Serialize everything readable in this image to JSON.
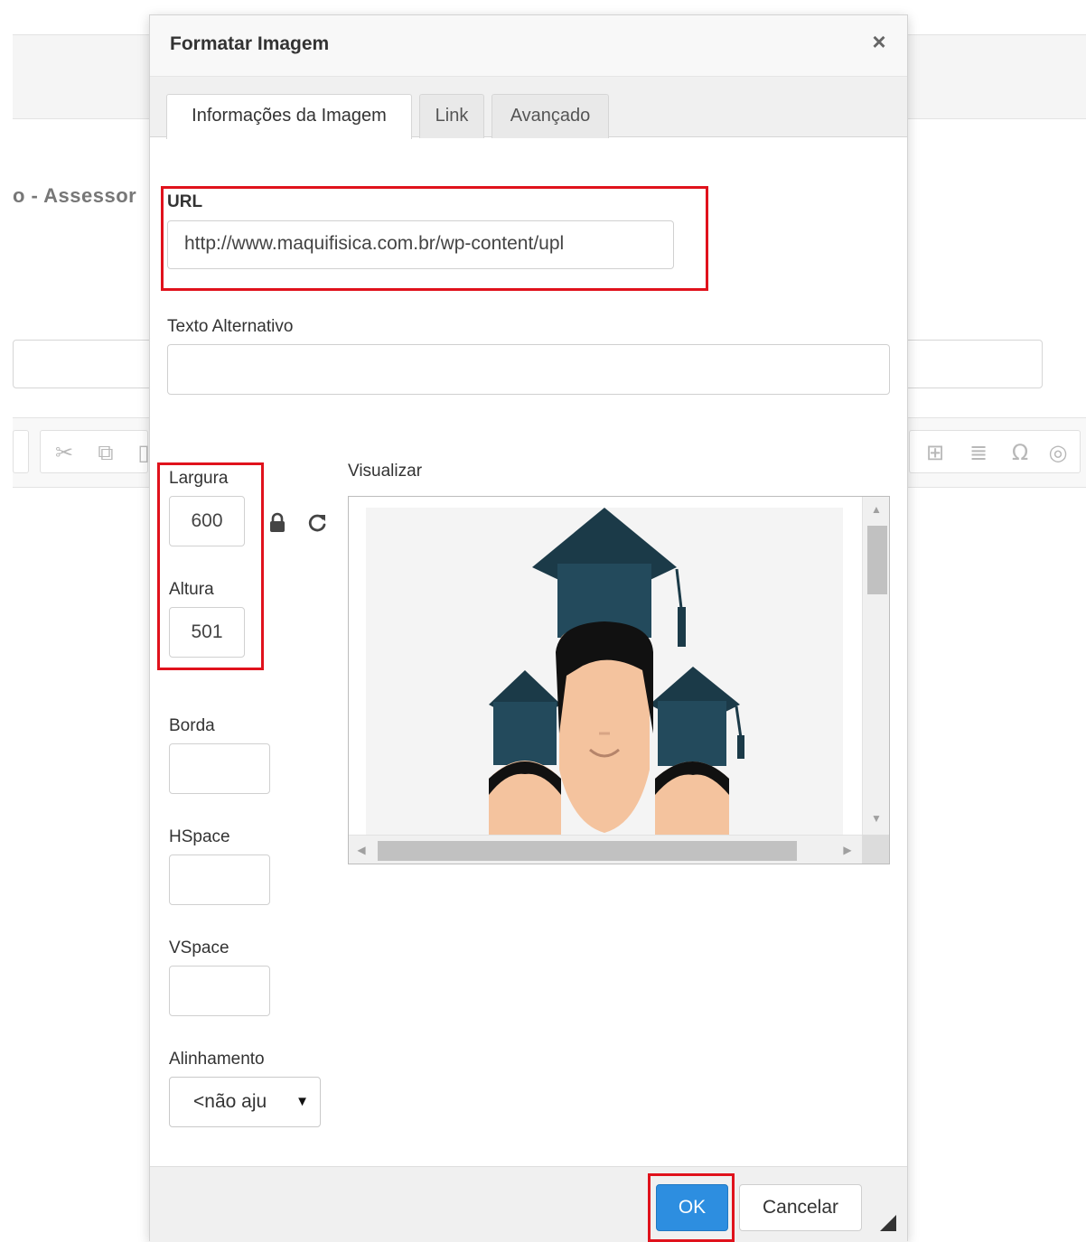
{
  "background": {
    "title_fragment": "o - Assessor"
  },
  "dialog": {
    "title": "Formatar Imagem",
    "close_glyph": "×",
    "tabs": [
      {
        "label": "Informações da Imagem",
        "active": true
      },
      {
        "label": "Link",
        "active": false
      },
      {
        "label": "Avançado",
        "active": false
      }
    ],
    "url": {
      "label": "URL",
      "value": "http://www.maquifisica.com.br/wp-content/upl"
    },
    "alt_text": {
      "label": "Texto Alternativo",
      "value": ""
    },
    "width": {
      "label": "Largura",
      "value": "600"
    },
    "height": {
      "label": "Altura",
      "value": "501"
    },
    "border": {
      "label": "Borda",
      "value": ""
    },
    "hspace": {
      "label": "HSpace",
      "value": ""
    },
    "vspace": {
      "label": "VSpace",
      "value": ""
    },
    "alignment": {
      "label": "Alinhamento",
      "selected": "<não aju"
    },
    "preview": {
      "label": "Visualizar"
    },
    "buttons": {
      "ok": "OK",
      "cancel": "Cancelar"
    },
    "icons": [
      "lock-icon",
      "reset-size-icon",
      "resize-grip-icon"
    ]
  },
  "colors": {
    "highlight": "#e0121c",
    "primary_button": "#2d8ee0",
    "cap": "#1f3d4c"
  }
}
